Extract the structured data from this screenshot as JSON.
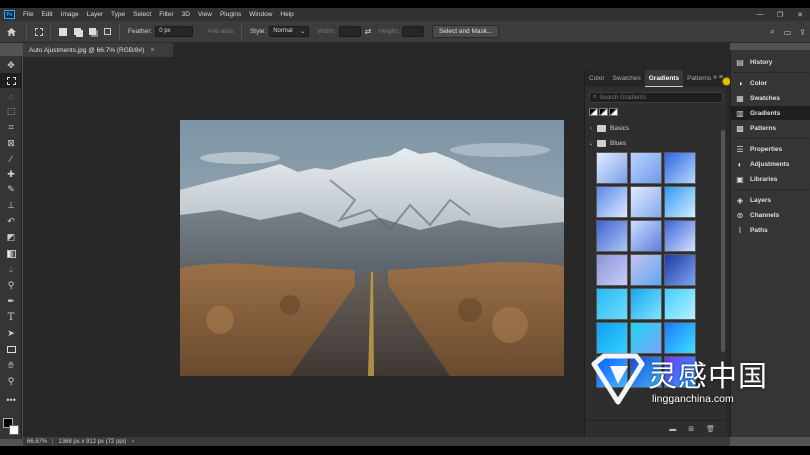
{
  "app": {
    "logo": "Ps"
  },
  "menu": [
    "File",
    "Edit",
    "Image",
    "Layer",
    "Type",
    "Select",
    "Filter",
    "3D",
    "View",
    "Plugins",
    "Window",
    "Help"
  ],
  "window_controls": [
    "—",
    "❐",
    "✕"
  ],
  "options_bar": {
    "feather_label": "Feather:",
    "feather_value": "0 px",
    "antialias_label": "Anti-alias",
    "style_label": "Style:",
    "style_value": "Normal",
    "width_label": "Width:",
    "height_label": "Height:",
    "select_mask_label": "Select and Mask..."
  },
  "document": {
    "tab_title": "Auto Ajustments.jpg @ 66.7% (RGB/8#)",
    "close_glyph": "×"
  },
  "status": {
    "zoom": "66.67%",
    "info": "1368 px x 912 px (72 ppi)",
    "arrow": "›"
  },
  "gradients_panel": {
    "tabs": [
      "Color",
      "Swatches",
      "Gradients",
      "Patterns"
    ],
    "active_tab": "Gradients",
    "menu_glyph": "»  ≡",
    "search_placeholder": "Search Gradients",
    "folders": [
      {
        "name": "Basics",
        "expanded": false
      },
      {
        "name": "Blues",
        "expanded": true
      }
    ],
    "footer_icons": [
      "folder-icon",
      "new-gradient-icon",
      "trash-icon"
    ]
  },
  "dock": {
    "groups": [
      [
        {
          "label": "History",
          "icon": "history-icon"
        }
      ],
      [
        {
          "label": "Color",
          "icon": "color-icon"
        },
        {
          "label": "Swatches",
          "icon": "swatches-icon"
        },
        {
          "label": "Gradients",
          "icon": "gradients-icon",
          "active": true
        },
        {
          "label": "Patterns",
          "icon": "patterns-icon"
        }
      ],
      [
        {
          "label": "Properties",
          "icon": "properties-icon"
        },
        {
          "label": "Adjustments",
          "icon": "adjustments-icon"
        },
        {
          "label": "Libraries",
          "icon": "libraries-icon"
        }
      ],
      [
        {
          "label": "Layers",
          "icon": "layers-icon"
        },
        {
          "label": "Channels",
          "icon": "channels-icon"
        },
        {
          "label": "Paths",
          "icon": "paths-icon"
        }
      ]
    ]
  },
  "watermark": {
    "chinese": "灵感中国",
    "site": "lingganchina.com"
  },
  "colors": {
    "accent": "#31a8ff",
    "foreground_swatch": "#000000",
    "background_swatch": "#ffffff"
  }
}
